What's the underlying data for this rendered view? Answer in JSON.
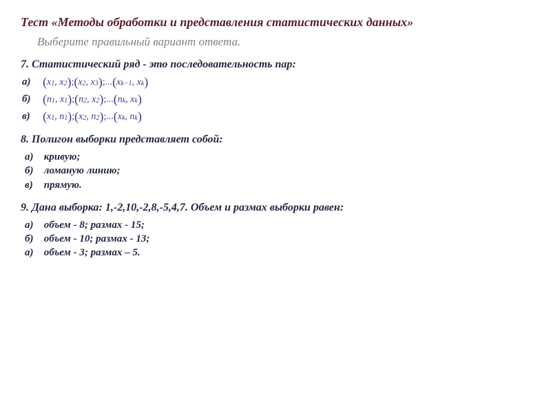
{
  "title": "Тест «Методы обработки и представления статистических данных»",
  "subtitle": "Выберите правильный вариант ответа.",
  "q7": {
    "prompt": "7.   Статистический ряд - это последовательность пар:",
    "a_label": "а)",
    "b_label": "б)",
    "c_label": "в)"
  },
  "q8": {
    "prompt": "8.    Полигон выборки представляет собой:",
    "a": {
      "label": "а)",
      "text": "кривую;"
    },
    "b": {
      "label": "б)",
      "text": "ломаную линию;"
    },
    "c": {
      "label": "в)",
      "text": "прямую."
    }
  },
  "q9": {
    "prompt": "9.  Дана выборка: 1,-2,10,-2,8,-5,4,7. Объем и  размах выборки равен:",
    "a": {
      "label": "а)",
      "text": "объем - 8; размах - 15;"
    },
    "b": {
      "label": "б)",
      "text": "объем - 10; размах - 13;"
    },
    "c": {
      "label": "а)",
      "text": "объем - 3; размах – 5."
    }
  }
}
